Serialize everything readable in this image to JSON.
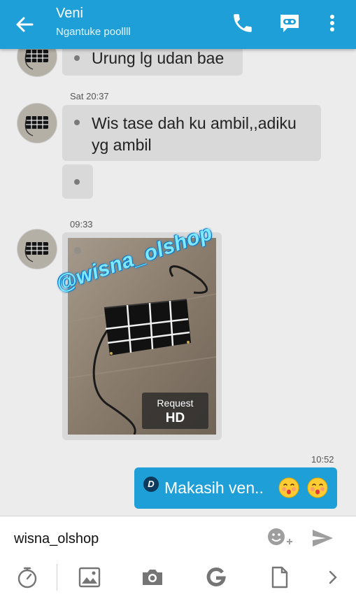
{
  "header": {
    "contact_name": "Veni",
    "status": "Ngantuke poollll"
  },
  "messages": [
    {
      "text": "Urung lg udan bae"
    },
    {
      "timestamp": "Sat 20:37",
      "text_line1": "Wis tase dah ku ambil,,adiku",
      "text_line2": "yg ambil"
    },
    {
      "timestamp": "09:33",
      "image_watermark": "@wisna_olshop",
      "request_label": "Request",
      "hd_label": "HD"
    },
    {
      "timestamp": "10:52",
      "badge": "D",
      "text": "Makasih ven.."
    }
  ],
  "input": {
    "value": "wisna_olshop"
  },
  "colors": {
    "accent": "#1f9fd8",
    "incoming_bubble": "#d9d9d9",
    "background": "#ececec"
  },
  "icons": [
    "back-arrow-icon",
    "phone-icon",
    "video-chat-icon",
    "more-vert-icon",
    "emoji-add-icon",
    "send-icon",
    "timer-icon",
    "gallery-icon",
    "camera-icon",
    "gif-icon",
    "file-icon",
    "chevron-right-icon"
  ]
}
